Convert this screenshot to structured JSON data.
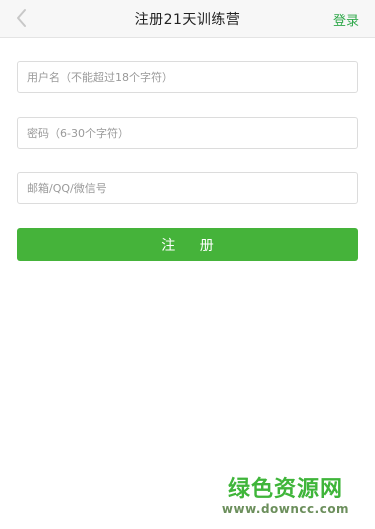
{
  "navbar": {
    "title": "注册21天训练营",
    "login_label": "登录",
    "back_icon": "chevron-left-icon"
  },
  "form": {
    "username_placeholder": "用户名（不能超过18个字符）",
    "username_value": "",
    "password_placeholder": "密码（6-30个字符）",
    "password_value": "",
    "email_placeholder": "邮箱/QQ/微信号",
    "email_value": "",
    "register_label": "注 册"
  },
  "watermark": {
    "title": "绿色资源网",
    "url": "www.downcc.com"
  },
  "colors": {
    "accent": "#45b33a",
    "login_link": "#2fa84a",
    "navbar_bg": "#f7f7f7"
  }
}
